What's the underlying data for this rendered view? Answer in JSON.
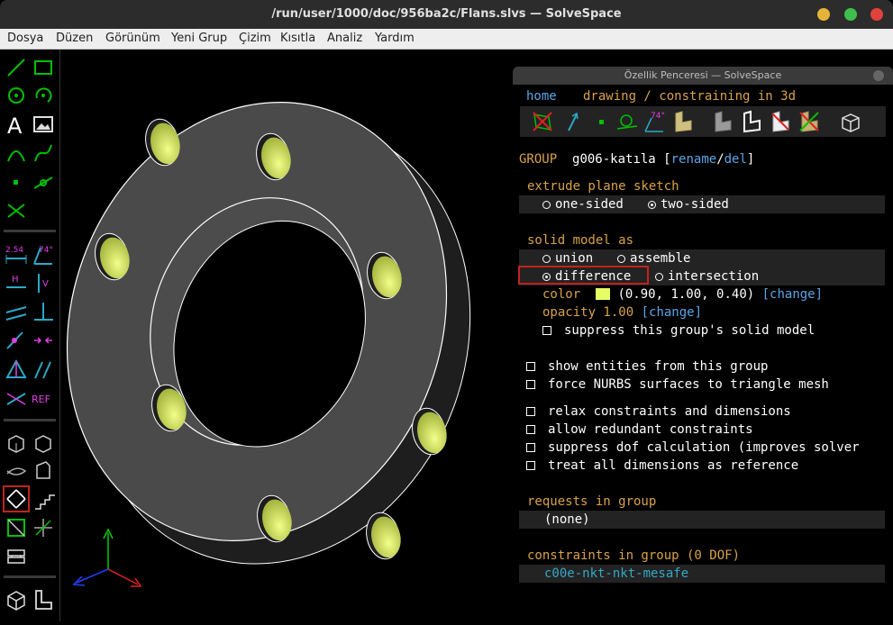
{
  "window": {
    "title": "/run/user/1000/doc/956ba2c/Flans.slvs — SolveSpace"
  },
  "menu": [
    "Dosya",
    "Düzen",
    "Görünüm",
    "Yeni Grup",
    "Çizim",
    "Kısıtla",
    "Analiz",
    "Yardım"
  ],
  "property_window": {
    "title": "Özellik Penceresi — SolveSpace",
    "nav_home": "home",
    "nav_path": "drawing / constraining in 3d",
    "group_label": "GROUP",
    "group_name": "g006-katıla",
    "rename": "rename",
    "slash": "/",
    "del": "del",
    "extrude_header": "extrude plane sketch",
    "one_sided": "one-sided",
    "two_sided": "two-sided",
    "solid_header": "solid model as",
    "union": "union",
    "assemble": "assemble",
    "difference": "difference",
    "intersection": "intersection",
    "color_label": "color",
    "color_value": "(0.90, 1.00, 0.40)",
    "color_swatch": "#e6ff66",
    "change": "[change]",
    "opacity_label": "opacity 1.00",
    "suppress_solid": "suppress this group's solid model",
    "show_entities": "show entities from this group",
    "force_nurbs": "force NURBS surfaces to triangle mesh",
    "relax": "relax constraints and dimensions",
    "allow_redundant": "allow redundant constraints",
    "suppress_dof": "suppress dof calculation (improves solver",
    "treat_ref": "treat all dimensions as reference",
    "requests_header": "requests in group",
    "requests_none": "(none)",
    "constraints_header": "constraints in group (0 DOF)",
    "constraint_item": "c00e-nkt-nkt-mesafe"
  },
  "toolbar_labels": {
    "dim": "2.54",
    "angle": "74°",
    "h": "H",
    "v": "V",
    "ref": "REF"
  },
  "icon_labels": {
    "angle": "74°"
  },
  "colors": {
    "accent_green": "#00b000",
    "magenta": "#e040e0",
    "cyan": "#2aa8c8",
    "highlight": "#c0241c"
  }
}
